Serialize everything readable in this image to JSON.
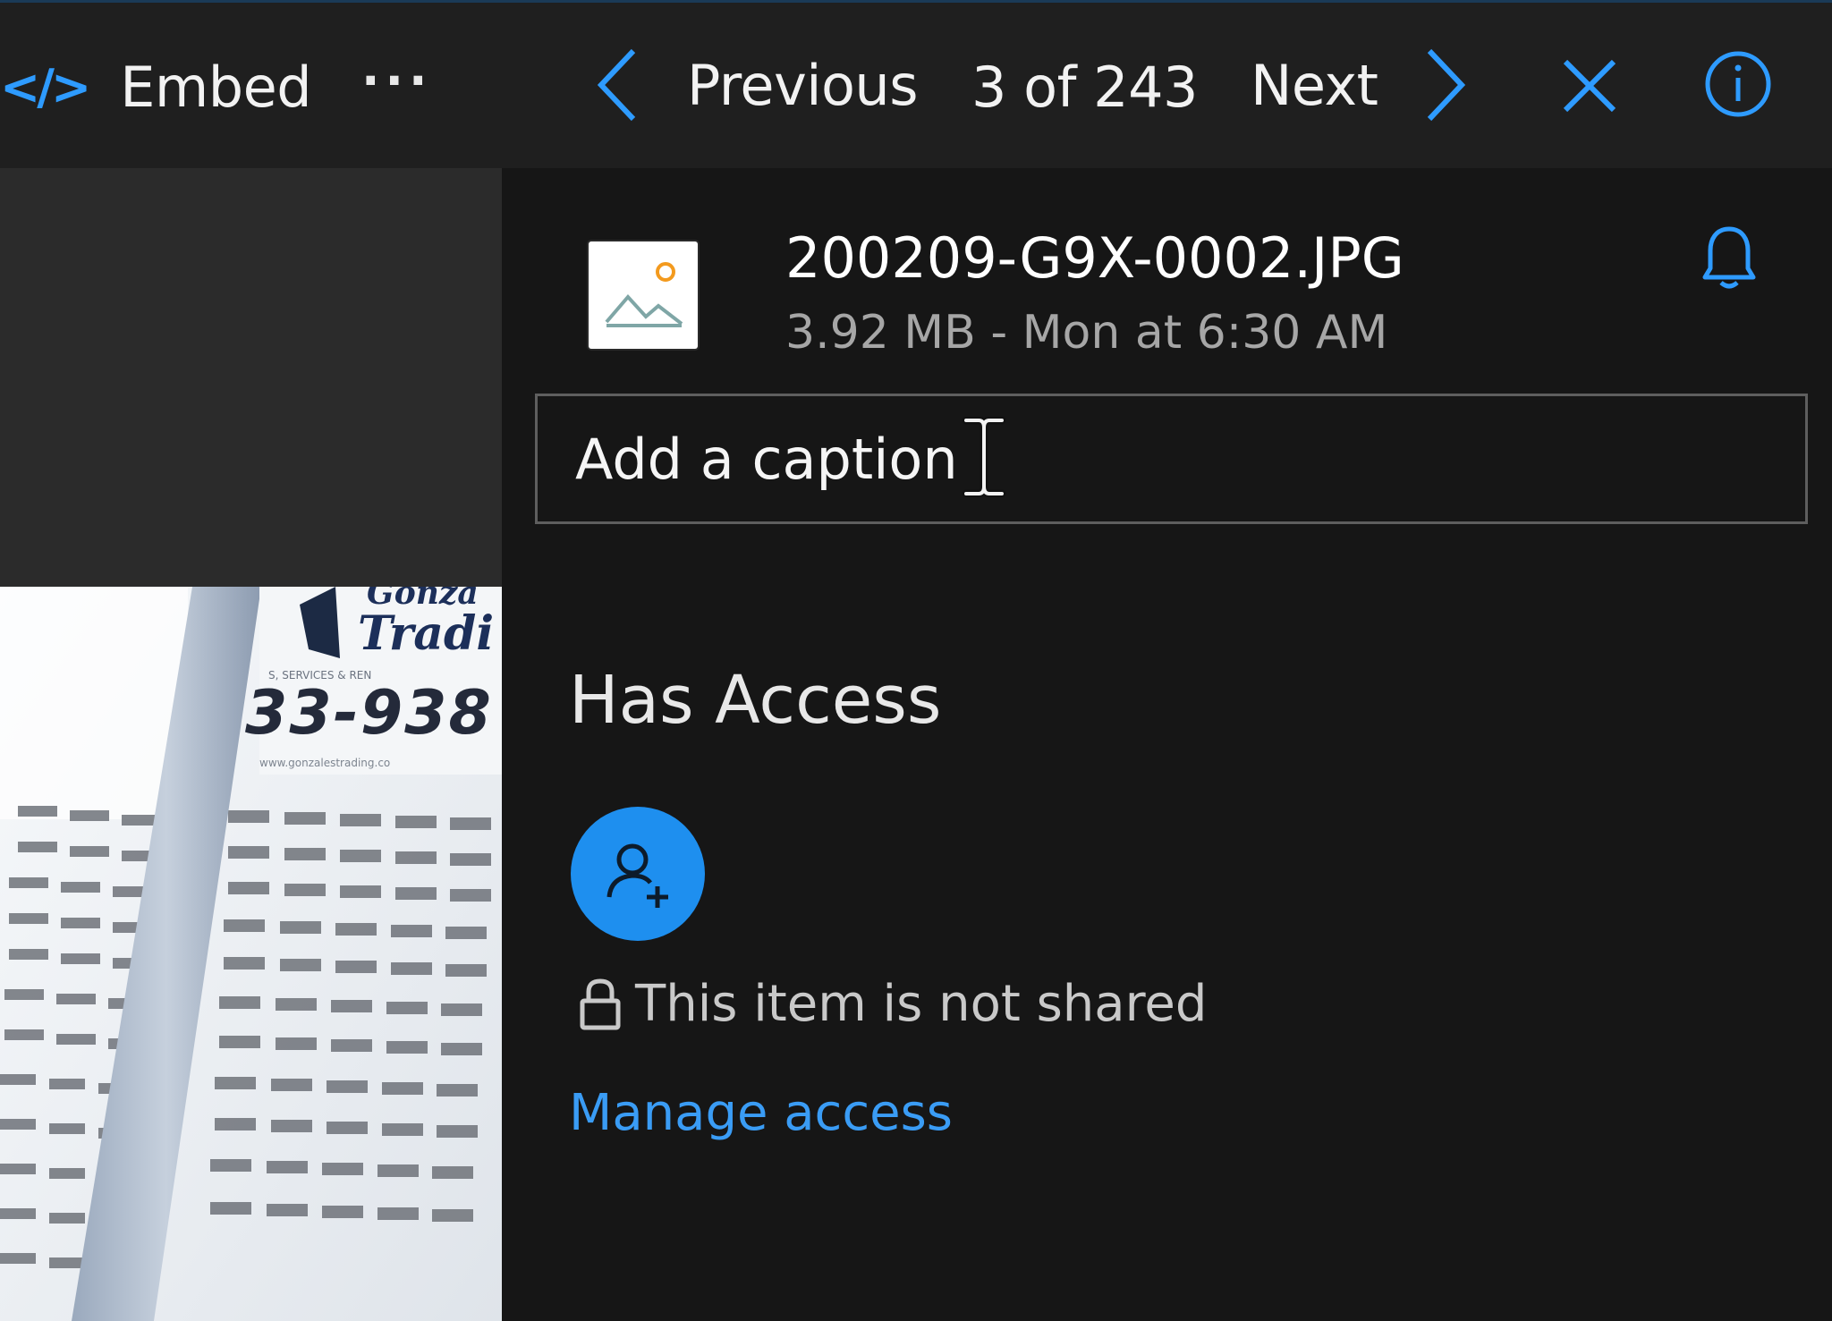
{
  "toolbar": {
    "embed_icon_glyph": "</>",
    "embed_label": "Embed",
    "more_glyph": "···",
    "previous_label": "Previous",
    "position_text": "3 of 243",
    "next_label": "Next",
    "icons": {
      "embed": "code-icon",
      "more": "more-icon",
      "previous": "chevron-left-icon",
      "next": "chevron-right-icon",
      "close": "close-icon",
      "info": "info-icon"
    }
  },
  "file": {
    "name": "200209-G9X-0002.JPG",
    "meta": "3.92 MB - Mon at 6:30 AM",
    "thumbnail_icon": "image-file-icon",
    "notify_icon": "bell-icon"
  },
  "caption": {
    "placeholder": "Add a caption",
    "value": ""
  },
  "access": {
    "heading": "Has Access",
    "add_person_icon": "add-person-icon",
    "lock_icon": "lock-icon",
    "status_text": "This item is not shared",
    "manage_link": "Manage access"
  },
  "photo_text": {
    "line1": "Gonza",
    "line2": "Tradi",
    "line3": "S, SERVICES & REN",
    "line4": "33-938",
    "line5": "www.gonzalestrading.co"
  },
  "colors": {
    "accent": "#2e9bff",
    "toolbar_bg": "#1f1f1f",
    "pane_bg": "#161616",
    "avatar_bg": "#1e8fef",
    "link": "#3a9cf5"
  }
}
